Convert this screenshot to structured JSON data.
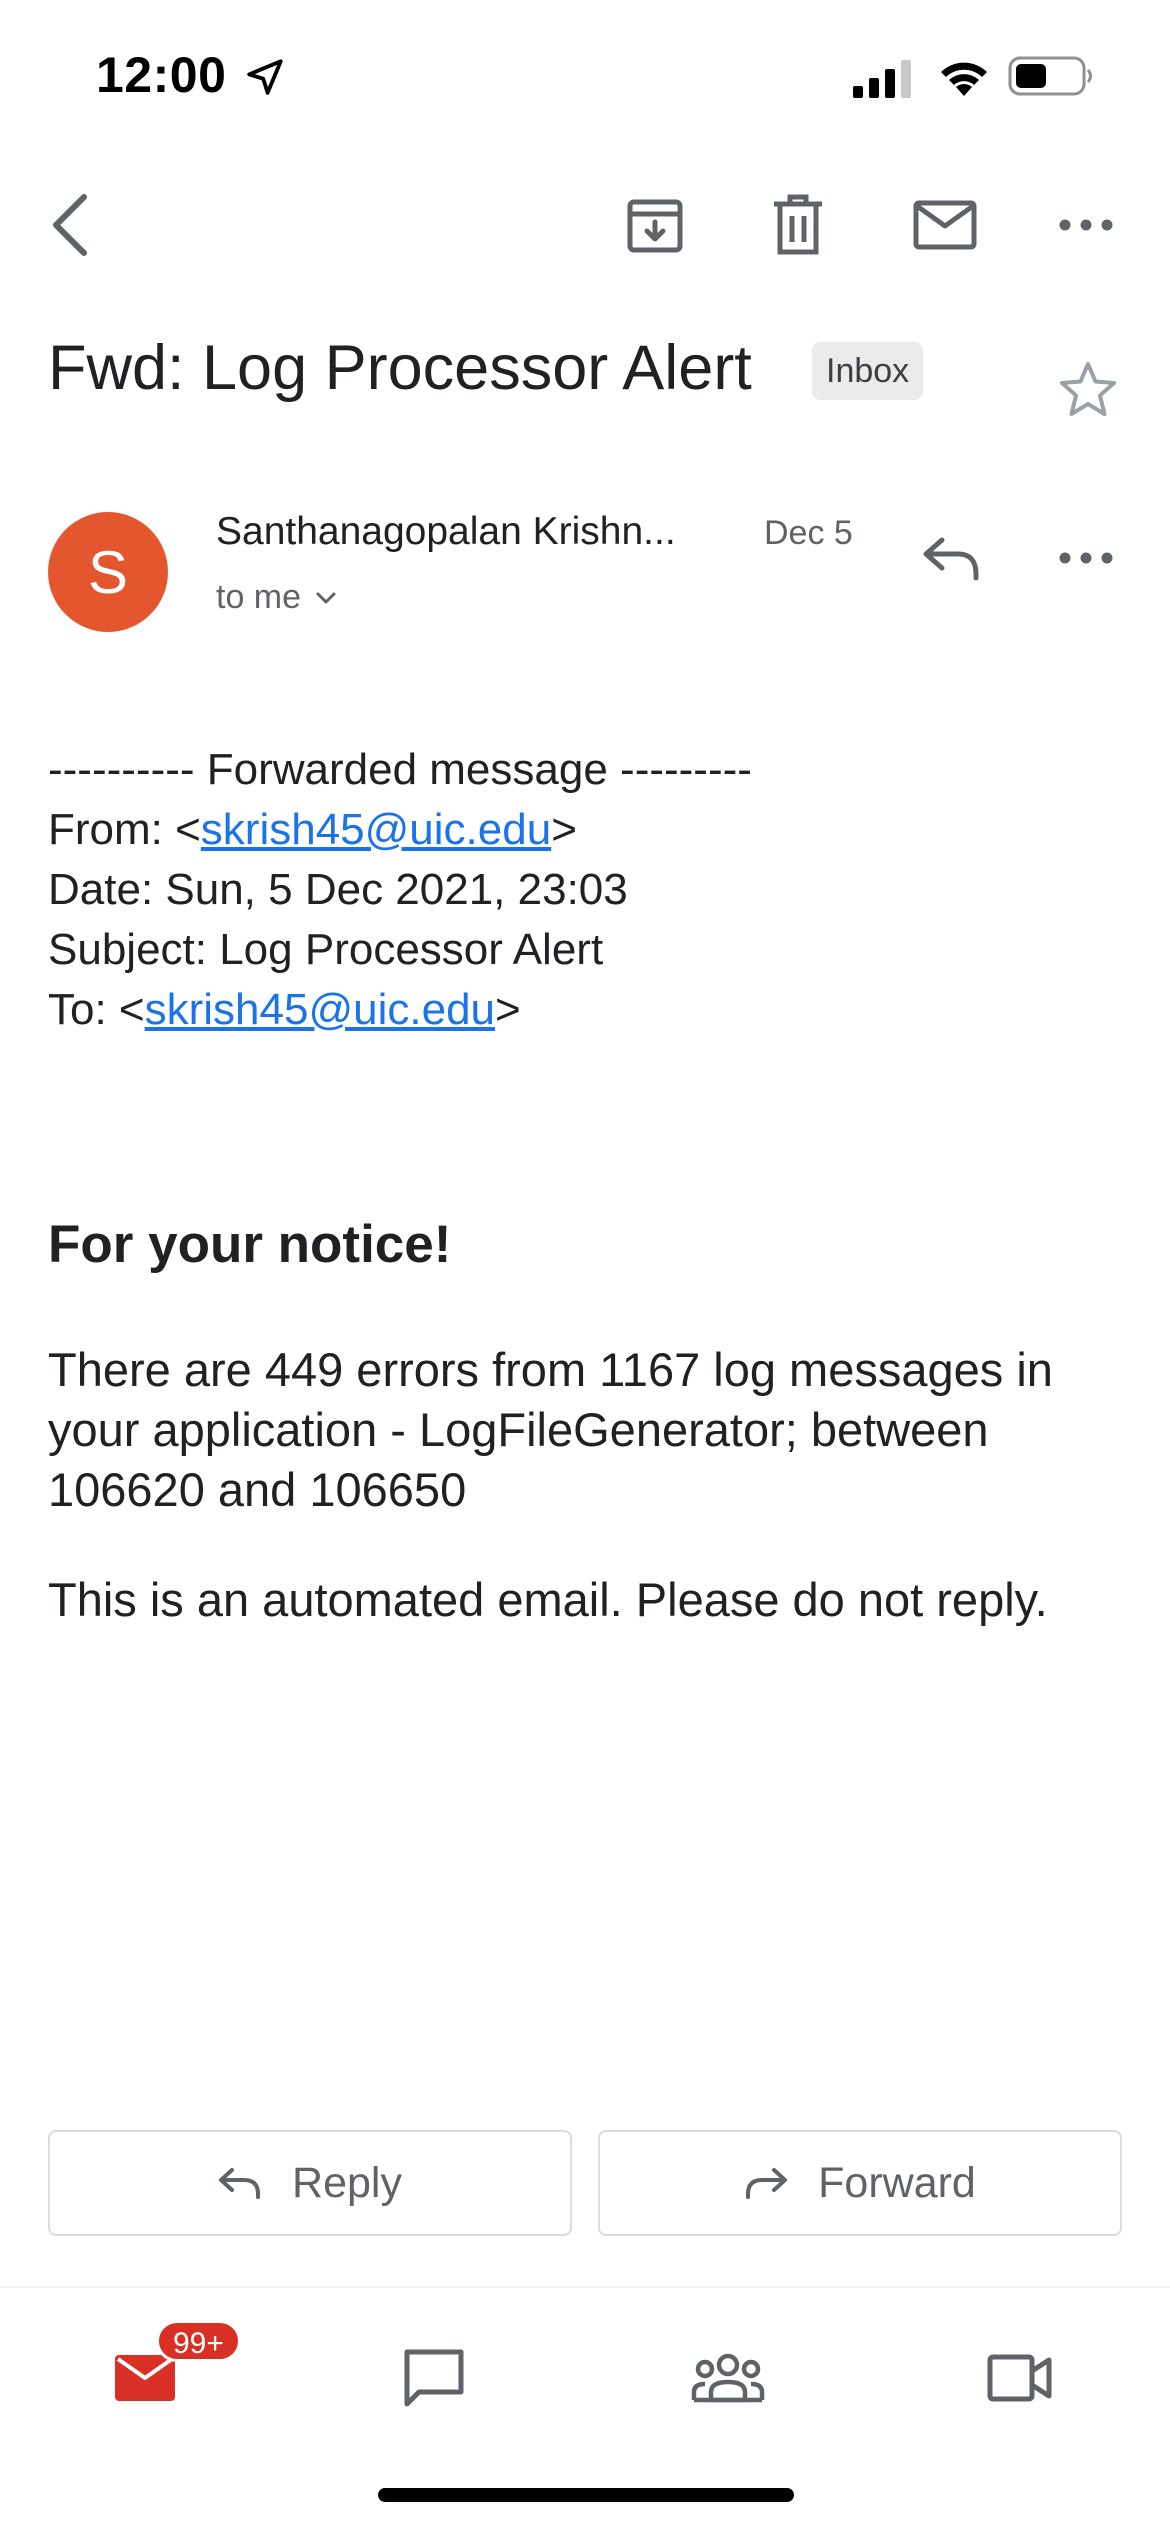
{
  "status_bar": {
    "time": "12:00"
  },
  "toolbar": {
    "icons": [
      "back-icon",
      "archive-icon",
      "delete-icon",
      "mark-unread-icon",
      "more-icon"
    ]
  },
  "email": {
    "subject": "Fwd: Log Processor Alert",
    "label": "Inbox",
    "sender_initial": "S",
    "sender_name": "Santhanagopalan Krishn...",
    "date": "Dec 5",
    "recipient": "to me",
    "avatar_color": "#e4572e",
    "forwarded": {
      "header": "---------- Forwarded message ---------",
      "from_prefix": "From: <",
      "from_email": "skrish45@uic.edu",
      "from_suffix": ">",
      "date_line": "Date: Sun, 5 Dec 2021, 23:03",
      "subject_line": "Subject: Log Processor Alert",
      "to_prefix": "To: <",
      "to_email": "skrish45@uic.edu",
      "to_suffix": ">"
    },
    "heading": "For your notice!",
    "paragraph1": "There are 449 errors from 1167 log messages in your application - LogFileGenerator; between 106620 and 106650",
    "paragraph2": "This is an automated email. Please do not reply."
  },
  "actions": {
    "reply_label": "Reply",
    "forward_label": "Forward"
  },
  "bottom_nav": {
    "mail_badge": "99+",
    "items": [
      "mail-icon",
      "chat-icon",
      "spaces-icon",
      "meet-icon"
    ],
    "accent_color": "#d93025"
  },
  "colors": {
    "link": "#1a73e8",
    "text": "#202124",
    "secondary": "#5f6368"
  }
}
